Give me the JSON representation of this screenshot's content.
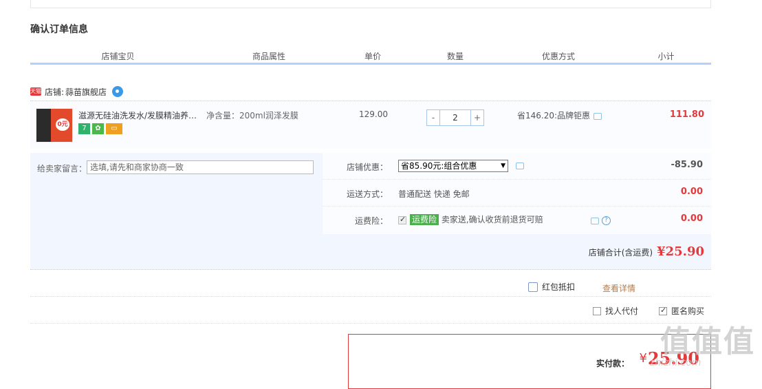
{
  "section_title": "确认订单信息",
  "columns": [
    "店铺宝贝",
    "商品属性",
    "单价",
    "数量",
    "优惠方式",
    "小计"
  ],
  "shop": {
    "logo_text": "天猫",
    "label": "店铺:",
    "name": "蒜苗旗舰店"
  },
  "item": {
    "image_badge_text": "0元",
    "title": "滋源无硅油洗发水/发膜精油养…",
    "badges": [
      {
        "icon": "seven-day-return-icon",
        "text": "7",
        "color": "#2fb36c"
      },
      {
        "icon": "quality-icon",
        "text": "✿",
        "color": "#4cb84c"
      },
      {
        "icon": "credit-card-icon",
        "text": "▭",
        "color": "#f0a020"
      }
    ],
    "attribute": "净含量：200ml润泽发膜",
    "price": "129.00",
    "quantity": "2",
    "qty_minus": "-",
    "qty_plus": "+",
    "promotion": "省146.20:品牌钜惠",
    "subtotal": "111.80"
  },
  "memo": {
    "label": "给卖家留言：",
    "placeholder": "选填,请先和商家协商一致"
  },
  "shop_discount": {
    "label": "店铺优惠：",
    "selected": "省85.90元:组合优惠",
    "amount": "-85.90"
  },
  "shipping": {
    "label": "运送方式：",
    "value": "普通配送 快递 免邮",
    "amount": "0.00"
  },
  "insurance": {
    "label": "运费险：",
    "tag": "运费险",
    "value": "卖家送,确认收货前退货可赔",
    "amount": "0.00"
  },
  "shop_total": {
    "label": "店铺合计(含运费)",
    "value": "¥25.90"
  },
  "redpack": {
    "label": "红包抵扣",
    "detail_link": "查看详情"
  },
  "options": {
    "proxy_pay": "找人代付",
    "anonymous": "匿名购买"
  },
  "payment": {
    "label": "实付款：",
    "currency": "¥",
    "amount": "25.90"
  },
  "watermark": {
    "text": "值值值",
    "url": "zhizhi.com"
  },
  "colors": {
    "accent": "#e4393c",
    "header_line": "#b2d1ff",
    "insurance_tag": "#4cae4c",
    "link": "#b57c4a"
  }
}
